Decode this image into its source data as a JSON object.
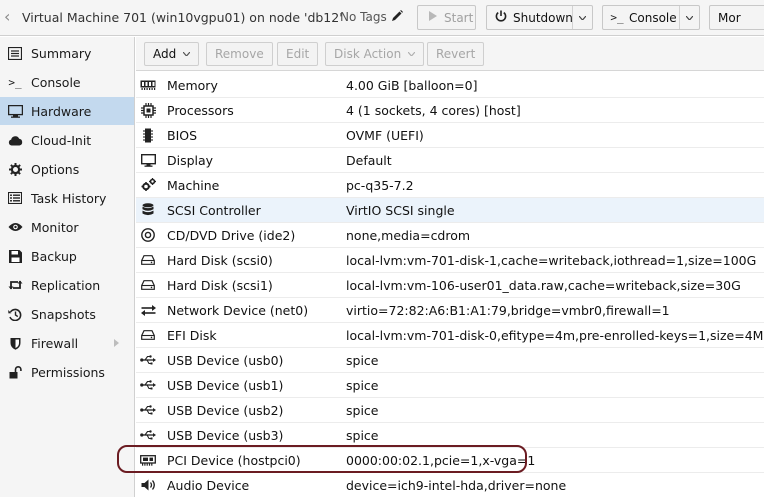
{
  "header": {
    "title": "Virtual Machine 701 (win10vgpu01) on node 'db12'",
    "tags": "No Tags",
    "buttons": {
      "start": "Start",
      "shutdown": "Shutdown",
      "console": "Console",
      "more": "Mor"
    }
  },
  "sidebar": {
    "items": [
      {
        "label": "Summary",
        "icon": "summary-icon"
      },
      {
        "label": "Console",
        "icon": "console-icon"
      },
      {
        "label": "Hardware",
        "icon": "hardware-icon",
        "active": true
      },
      {
        "label": "Cloud-Init",
        "icon": "cloud-icon"
      },
      {
        "label": "Options",
        "icon": "gear-icon"
      },
      {
        "label": "Task History",
        "icon": "list-icon"
      },
      {
        "label": "Monitor",
        "icon": "eye-icon"
      },
      {
        "label": "Backup",
        "icon": "floppy-icon"
      },
      {
        "label": "Replication",
        "icon": "retweet-icon"
      },
      {
        "label": "Snapshots",
        "icon": "history-icon"
      },
      {
        "label": "Firewall",
        "icon": "shield-icon"
      },
      {
        "label": "Permissions",
        "icon": "unlock-icon"
      }
    ]
  },
  "toolbar": {
    "add": "Add",
    "remove": "Remove",
    "edit": "Edit",
    "disk_action": "Disk Action",
    "revert": "Revert"
  },
  "hardware": {
    "rows": [
      {
        "name": "Memory",
        "value": "4.00 GiB [balloon=0]",
        "icon": "memory-icon"
      },
      {
        "name": "Processors",
        "value": "4 (1 sockets, 4 cores) [host]",
        "icon": "cpu-icon"
      },
      {
        "name": "BIOS",
        "value": "OVMF (UEFI)",
        "icon": "microchip-icon"
      },
      {
        "name": "Display",
        "value": "Default",
        "icon": "desktop-icon"
      },
      {
        "name": "Machine",
        "value": "pc-q35-7.2",
        "icon": "cogs-icon"
      },
      {
        "name": "SCSI Controller",
        "value": "VirtIO SCSI single",
        "icon": "database-icon"
      },
      {
        "name": "CD/DVD Drive (ide2)",
        "value": "none,media=cdrom",
        "icon": "cdrom-icon"
      },
      {
        "name": "Hard Disk (scsi0)",
        "value": "local-lvm:vm-701-disk-1,cache=writeback,iothread=1,size=100G",
        "icon": "hdd-icon"
      },
      {
        "name": "Hard Disk (scsi1)",
        "value": "local-lvm:vm-106-user01_data.raw,cache=writeback,size=30G",
        "icon": "hdd-icon"
      },
      {
        "name": "Network Device (net0)",
        "value": "virtio=72:82:A6:B1:A1:79,bridge=vmbr0,firewall=1",
        "icon": "exchange-icon"
      },
      {
        "name": "EFI Disk",
        "value": "local-lvm:vm-701-disk-0,efitype=4m,pre-enrolled-keys=1,size=4M",
        "icon": "hdd-icon"
      },
      {
        "name": "USB Device (usb0)",
        "value": "spice",
        "icon": "usb-icon"
      },
      {
        "name": "USB Device (usb1)",
        "value": "spice",
        "icon": "usb-icon"
      },
      {
        "name": "USB Device (usb2)",
        "value": "spice",
        "icon": "usb-icon"
      },
      {
        "name": "USB Device (usb3)",
        "value": "spice",
        "icon": "usb-icon"
      },
      {
        "name": "PCI Device (hostpci0)",
        "value": "0000:00:02.1,pcie=1,x-vga=1",
        "icon": "pci-card-icon"
      },
      {
        "name": "Audio Device",
        "value": "device=ich9-intel-hda,driver=none",
        "icon": "volume-icon"
      }
    ]
  },
  "colors": {
    "active_nav": "#c3d9ee",
    "selected_row": "#ebf3fb",
    "highlight_ring": "#6b1c22"
  }
}
